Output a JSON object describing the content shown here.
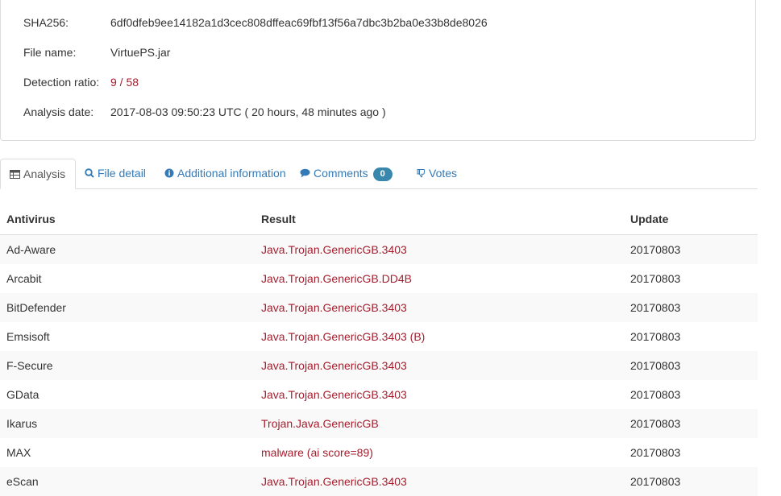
{
  "summary": {
    "sha256": {
      "label": "SHA256:",
      "value": "6df0dfeb9ee14182a1d3cec808dffeac69fbf13f56a7dbc3b2ba0e33b8de8026"
    },
    "file_name": {
      "label": "File name:",
      "value": "VirtuePS.jar"
    },
    "detection_ratio": {
      "label": "Detection ratio:",
      "value": "9 / 58"
    },
    "analysis_date": {
      "label": "Analysis date:",
      "value": "2017-08-03 09:50:23 UTC ( 20 hours, 48 minutes ago )"
    }
  },
  "tabs": [
    {
      "label": "Analysis",
      "icon": "table-icon",
      "active": true
    },
    {
      "label": "File detail",
      "icon": "search-icon"
    },
    {
      "label": "Additional information",
      "icon": "info-icon"
    },
    {
      "label": "Comments",
      "icon": "comment-icon",
      "badge": "0"
    },
    {
      "label": "Votes",
      "icon": "thumbs-down-icon"
    }
  ],
  "table": {
    "headers": {
      "antivirus": "Antivirus",
      "result": "Result",
      "update": "Update"
    },
    "rows": [
      {
        "antivirus": "Ad-Aware",
        "result": "Java.Trojan.GenericGB.3403",
        "update": "20170803"
      },
      {
        "antivirus": "Arcabit",
        "result": "Java.Trojan.GenericGB.DD4B",
        "update": "20170803"
      },
      {
        "antivirus": "BitDefender",
        "result": "Java.Trojan.GenericGB.3403",
        "update": "20170803"
      },
      {
        "antivirus": "Emsisoft",
        "result": "Java.Trojan.GenericGB.3403 (B)",
        "update": "20170803"
      },
      {
        "antivirus": "F-Secure",
        "result": "Java.Trojan.GenericGB.3403",
        "update": "20170803"
      },
      {
        "antivirus": "GData",
        "result": "Java.Trojan.GenericGB.3403",
        "update": "20170803"
      },
      {
        "antivirus": "Ikarus",
        "result": "Trojan.Java.GenericGB",
        "update": "20170803"
      },
      {
        "antivirus": "MAX",
        "result": "malware (ai score=89)",
        "update": "20170803"
      },
      {
        "antivirus": "eScan",
        "result": "Java.Trojan.GenericGB.3403",
        "update": "20170803"
      }
    ]
  },
  "colors": {
    "link": "#337ab7",
    "detection": "#a51d2d",
    "badge": "#3a87ad",
    "stripe": "#f9f9f9",
    "border": "#dddddd"
  }
}
